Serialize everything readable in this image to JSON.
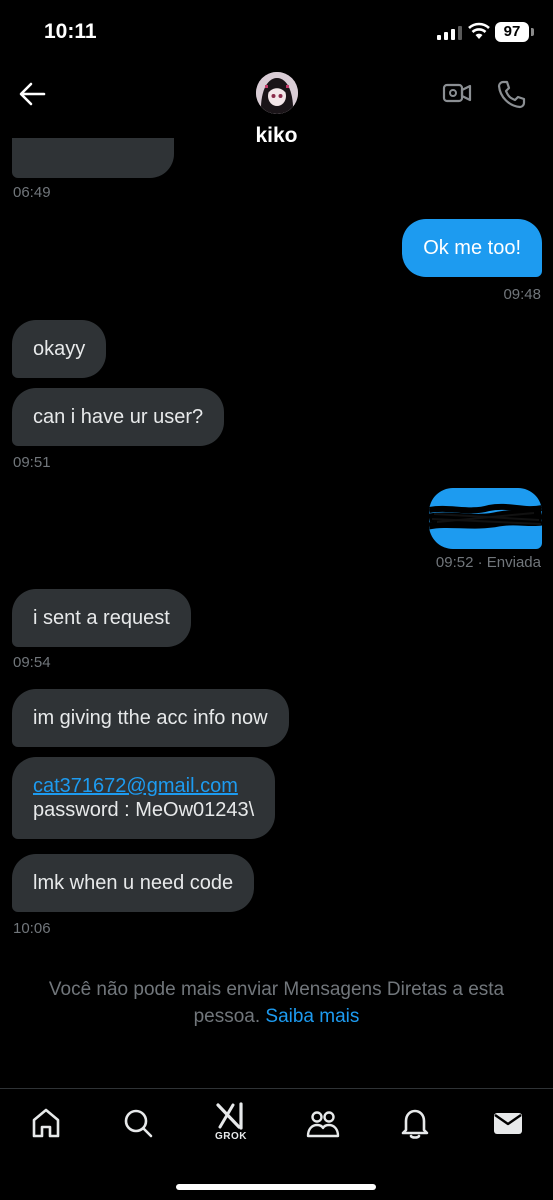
{
  "status_bar": {
    "time": "10:11",
    "battery": "97"
  },
  "header": {
    "contact_name": "kiko"
  },
  "messages": [
    {
      "direction": "in",
      "text": "",
      "time": "06:49"
    },
    {
      "direction": "out",
      "text": "Ok me too!",
      "time": "09:48"
    },
    {
      "direction": "in",
      "text": "okayy",
      "time": ""
    },
    {
      "direction": "in",
      "text": "can i have ur user?",
      "time": "09:51"
    },
    {
      "direction": "out",
      "text": "",
      "time": "09:52 · Enviada",
      "redacted": true
    },
    {
      "direction": "in",
      "text": "i sent a request",
      "time": "09:54"
    },
    {
      "direction": "in",
      "text": "im giving tthe acc info now",
      "time": ""
    },
    {
      "direction": "in",
      "email": "cat371672@gmail.com",
      "text": "password : MeOw01243\\",
      "time": ""
    },
    {
      "direction": "in",
      "text": "lmk when u need code",
      "time": "10:06"
    }
  ],
  "notice": {
    "text": "Você não pode mais enviar Mensagens Diretas a esta pessoa.",
    "link": "Saiba mais"
  },
  "nav": {
    "grok_label": "GROK",
    "items": [
      "home-icon",
      "search-icon",
      "grok-icon",
      "communities-icon",
      "notifications-icon",
      "messages-icon"
    ]
  },
  "colors": {
    "background": "#000000",
    "incoming_bubble": "#2f3336",
    "outgoing_bubble": "#1d9bf0",
    "muted_text": "#71767b",
    "link": "#1d9bf0"
  }
}
